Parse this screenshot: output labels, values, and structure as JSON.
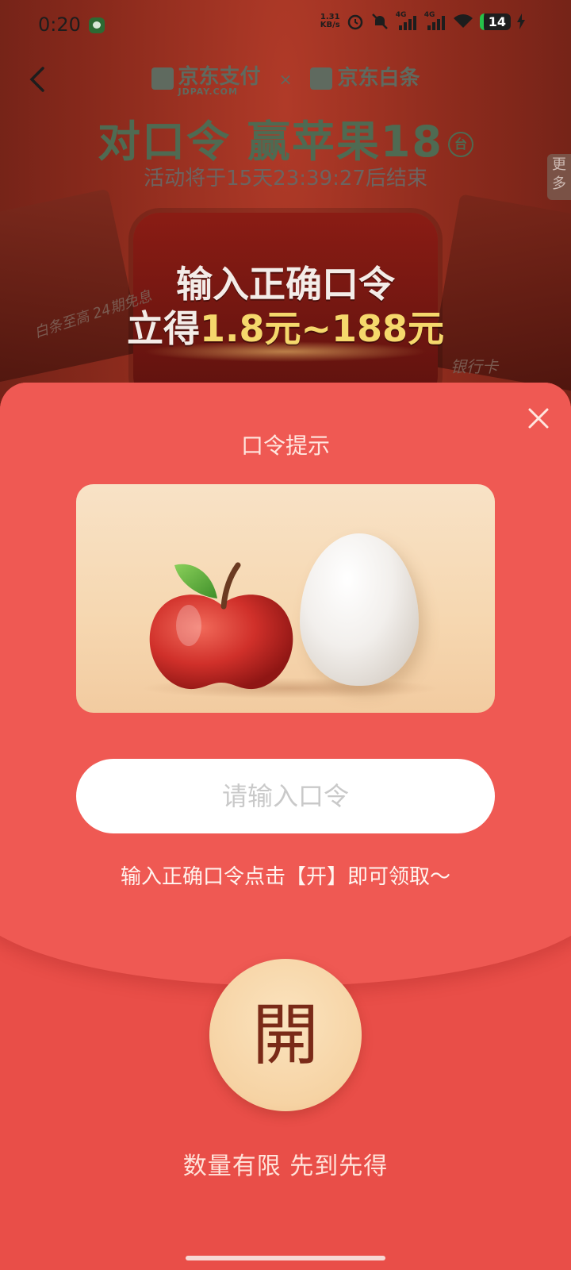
{
  "status_bar": {
    "time": "0:20",
    "net_speed_value": "1.31",
    "net_speed_unit": "KB/s",
    "signal_1_label": "4G",
    "signal_2_label": "4G",
    "battery": "14"
  },
  "header": {
    "brand_left": "京东支付",
    "brand_left_sub": "JDPAY.COM",
    "brand_sep": "×",
    "brand_right": "京东白条",
    "title": "对口令 赢苹果18",
    "title_unit": "台",
    "countdown": "活动将于15天23:39:27后结束",
    "more_tab": "更多"
  },
  "banner": {
    "line1": "输入正确口令",
    "line2_prefix": "立得",
    "line2_amount": "1.8元~188元",
    "hand_left": "白条至高 24期免息",
    "hand_right": "银行卡"
  },
  "sheet": {
    "title": "口令提示",
    "input_placeholder": "请输入口令",
    "input_value": "",
    "tip": "输入正确口令点击【开】即可领取～",
    "open_label": "開",
    "limit_text": "数量有限 先到先得"
  },
  "colors": {
    "sheet_bg": "#ea524c",
    "open_button": "#f6d3a4",
    "open_text": "#7a2a18"
  },
  "icons": {
    "back": "chevron-left-icon",
    "close": "close-icon",
    "hint_image": "apple-and-egg-illustration"
  }
}
